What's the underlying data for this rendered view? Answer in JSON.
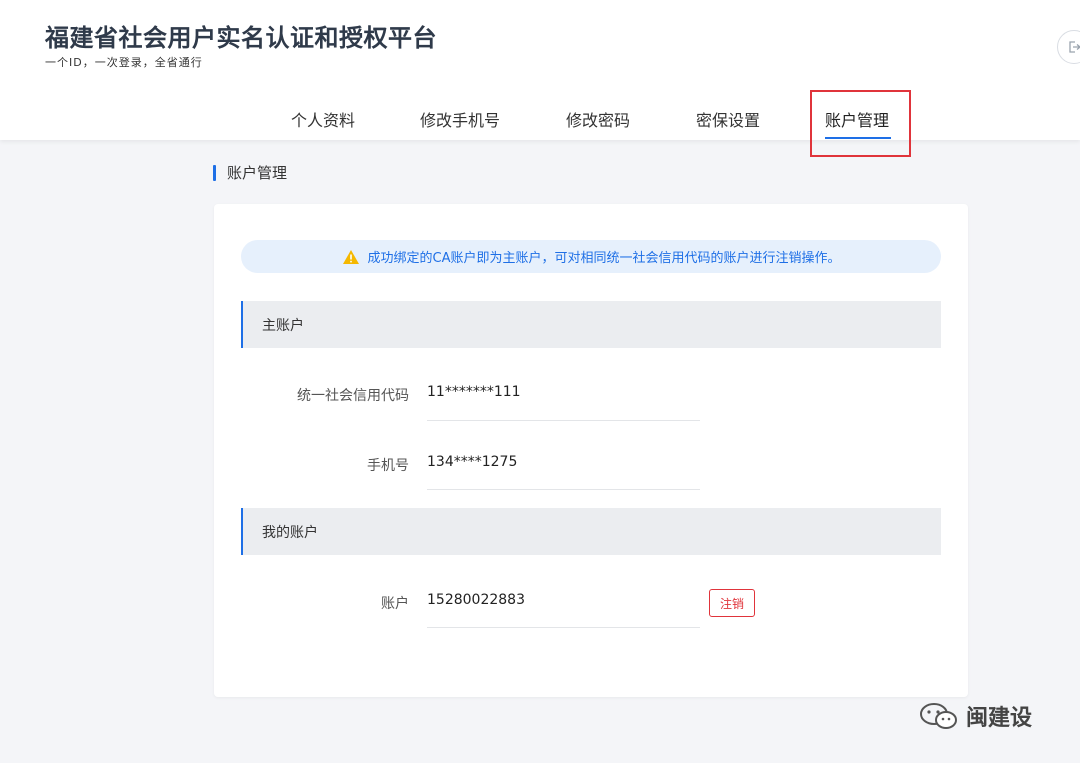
{
  "header": {
    "title": "福建省社会用户实名认证和授权平台",
    "subtitle": "一个ID，一次登录，全省通行"
  },
  "nav": {
    "tabs": [
      {
        "label": "个人资料"
      },
      {
        "label": "修改手机号"
      },
      {
        "label": "修改密码"
      },
      {
        "label": "密保设置"
      },
      {
        "label": "账户管理",
        "active": true
      }
    ]
  },
  "section": {
    "title": "账户管理"
  },
  "notice": {
    "text": "成功绑定的CA账户即为主账户，可对相同统一社会信用代码的账户进行注销操作。",
    "icon": "warning-icon"
  },
  "main_account": {
    "header": "主账户",
    "fields": [
      {
        "label": "统一社会信用代码",
        "value": "11*******111"
      },
      {
        "label": "手机号",
        "value": "134****1275"
      }
    ]
  },
  "my_account": {
    "header": "我的账户",
    "fields": [
      {
        "label": "账户",
        "value": "15280022883"
      }
    ],
    "cancel_label": "注销"
  },
  "watermark": {
    "text": "闽建设"
  },
  "colors": {
    "accent": "#1e6fe6",
    "danger": "#e0343b",
    "notice_bg": "#e6f0fc",
    "group_bg": "#ebedf0",
    "page_bg": "#f4f5f8"
  }
}
